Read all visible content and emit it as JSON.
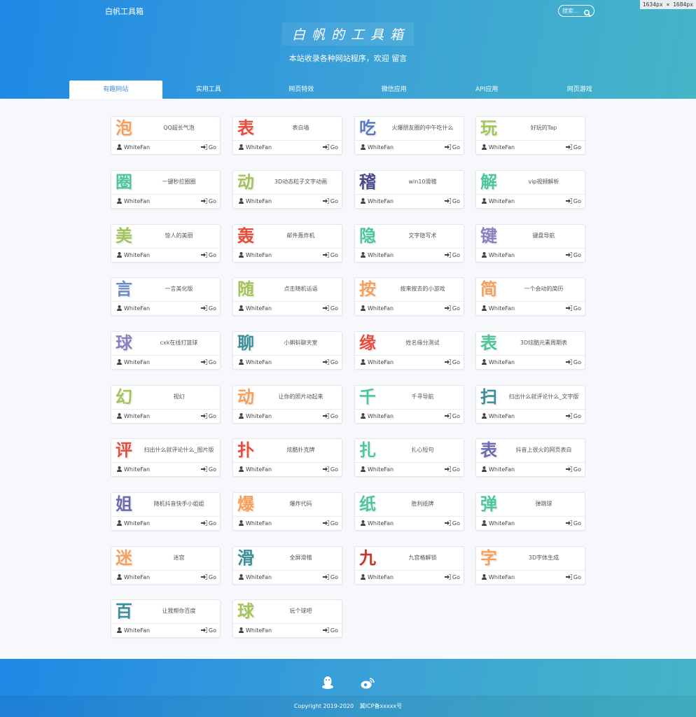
{
  "header": {
    "logo": "白帆工具箱",
    "title": "白帆的工具箱",
    "subtitle": "本站收录各种网站程序，欢迎 留言",
    "search_placeholder": "搜索...",
    "dims": "1634px × 1684px"
  },
  "tabs": [
    {
      "label": "有趣网站",
      "active": true
    },
    {
      "label": "实用工具",
      "active": false
    },
    {
      "label": "网页特效",
      "active": false
    },
    {
      "label": "微信应用",
      "active": false
    },
    {
      "label": "API应用",
      "active": false
    },
    {
      "label": "网页游戏",
      "active": false
    }
  ],
  "card_author": "WhiteFan",
  "card_go": "Go",
  "cards": [
    {
      "char": "泡",
      "desc": "QQ超长气泡",
      "color": "#f5a05c"
    },
    {
      "char": "表",
      "desc": "表白墙",
      "color": "#e74c3c"
    },
    {
      "char": "吃",
      "desc": "火爆朋友圈的中午吃什么",
      "color": "#5b7bc0"
    },
    {
      "char": "玩",
      "desc": "好玩的Tap",
      "color": "#a3c45a"
    },
    {
      "char": "圈",
      "desc": "一键秒拉圈圈",
      "color": "#4cc79a"
    },
    {
      "char": "动",
      "desc": "3D动态粒子文字动画",
      "color": "#a3c45a"
    },
    {
      "char": "稽",
      "desc": "win10滑稽",
      "color": "#4a4a8a"
    },
    {
      "char": "解",
      "desc": "vip视频解析",
      "color": "#4cc79a"
    },
    {
      "char": "美",
      "desc": "惊人的美丽",
      "color": "#a3c45a"
    },
    {
      "char": "轰",
      "desc": "邮件轰炸机",
      "color": "#e74c3c"
    },
    {
      "char": "隐",
      "desc": "文字隐写术",
      "color": "#4cc79a"
    },
    {
      "char": "键",
      "desc": "键盘导航",
      "color": "#8b7fc0"
    },
    {
      "char": "言",
      "desc": "一言美化版",
      "color": "#6b8bc8"
    },
    {
      "char": "随",
      "desc": "点击随机话语",
      "color": "#a3c45a"
    },
    {
      "char": "按",
      "desc": "按来按去的小游戏",
      "color": "#f5a05c"
    },
    {
      "char": "简",
      "desc": "一个会动的简历",
      "color": "#f5a05c"
    },
    {
      "char": "球",
      "desc": "cxk在线打篮球",
      "color": "#8b7fc0"
    },
    {
      "char": "聊",
      "desc": "小蝌蚪聊天室",
      "color": "#3a8e9a"
    },
    {
      "char": "缘",
      "desc": "姓名缘分测试",
      "color": "#e74c3c"
    },
    {
      "char": "表",
      "desc": "3D炫酷元素周期表",
      "color": "#4cc79a"
    },
    {
      "char": "幻",
      "desc": "视幻",
      "color": "#a3c45a"
    },
    {
      "char": "动",
      "desc": "让你的照片动起来",
      "color": "#f5a05c"
    },
    {
      "char": "千",
      "desc": "千寻导航",
      "color": "#4cc79a"
    },
    {
      "char": "扫",
      "desc": "扫出什么就评论什么_文字版",
      "color": "#3a8e9a"
    },
    {
      "char": "评",
      "desc": "扫出什么就评论什么_图片版",
      "color": "#e74c3c"
    },
    {
      "char": "扑",
      "desc": "炫酷扑克牌",
      "color": "#e74c3c"
    },
    {
      "char": "扎",
      "desc": "扎心短句",
      "color": "#4cc79a"
    },
    {
      "char": "表",
      "desc": "抖音上很火的网页表白",
      "color": "#6b6bb0"
    },
    {
      "char": "姐",
      "desc": "随机抖音快手小姐姐",
      "color": "#6b6bb0"
    },
    {
      "char": "爆",
      "desc": "爆炸代码",
      "color": "#f5a05c"
    },
    {
      "char": "纸",
      "desc": "胜利纸牌",
      "color": "#4cc79a"
    },
    {
      "char": "弹",
      "desc": "弹跳球",
      "color": "#4cc79a"
    },
    {
      "char": "迷",
      "desc": "迷宫",
      "color": "#f5a05c"
    },
    {
      "char": "滑",
      "desc": "全屏滑稽",
      "color": "#3a8e9a"
    },
    {
      "char": "九",
      "desc": "九宫格解锁",
      "color": "#c0392b"
    },
    {
      "char": "字",
      "desc": "3D字体生成",
      "color": "#f5a05c"
    },
    {
      "char": "百",
      "desc": "让我帮你百度",
      "color": "#3a8e9a"
    },
    {
      "char": "球",
      "desc": "玩个球吧",
      "color": "#a3c45a"
    }
  ],
  "footer": {
    "copyright": "Copyright 2019-2020",
    "icp": "冀ICP备xxxxx号"
  }
}
